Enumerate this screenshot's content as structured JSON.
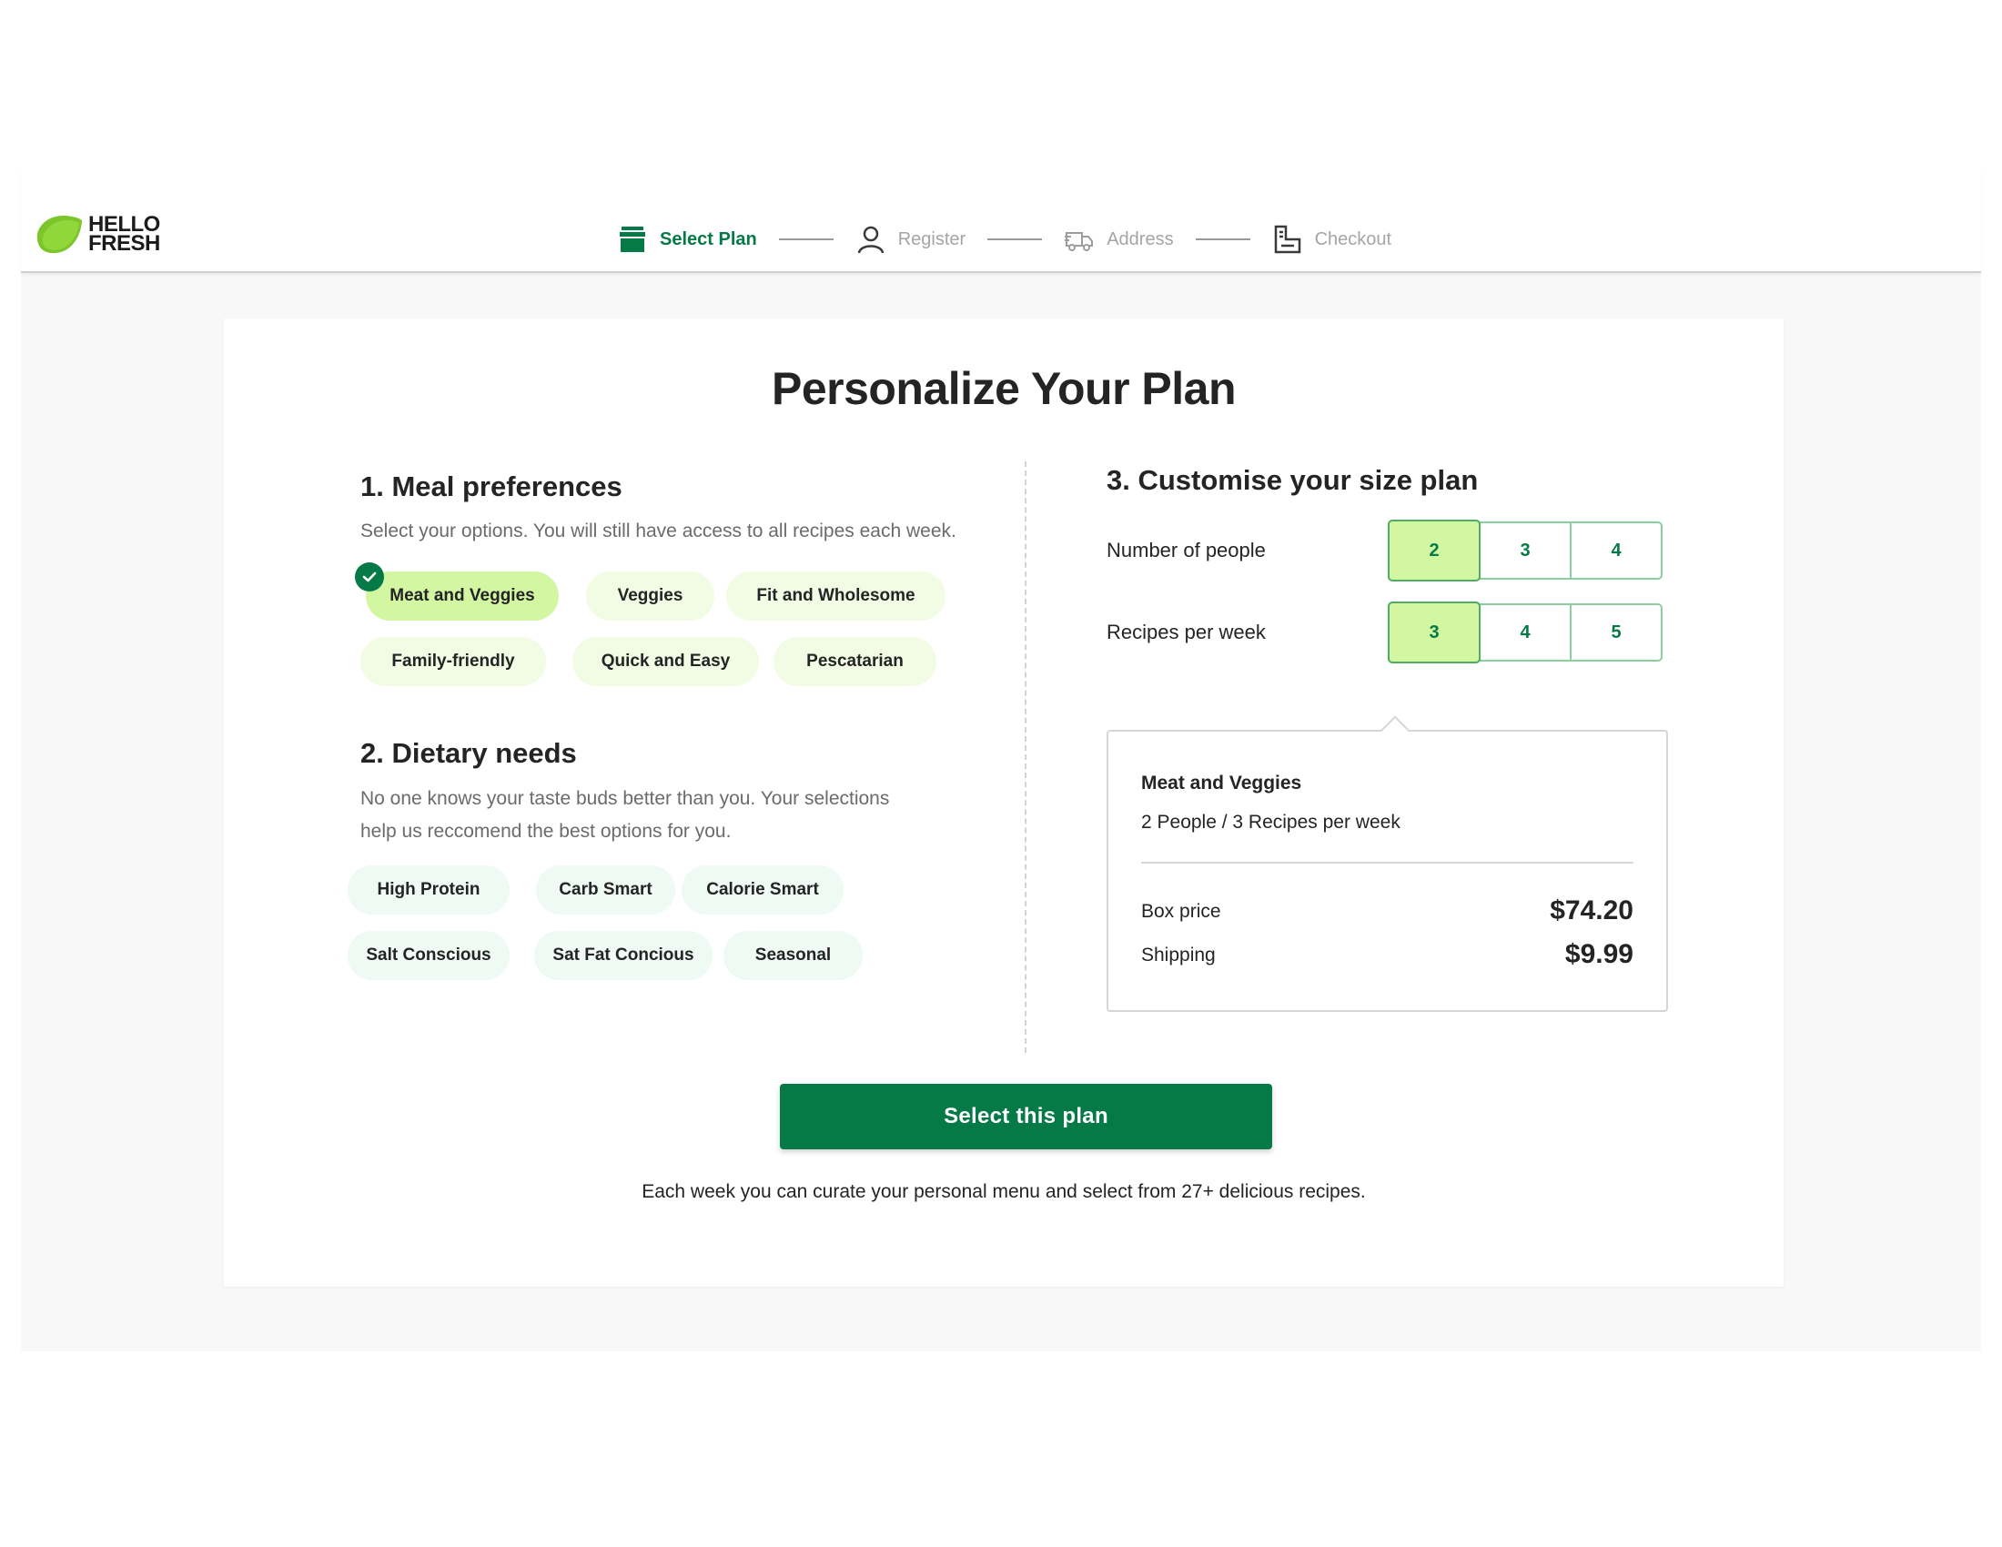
{
  "brand": {
    "logo_line1": "HELLO",
    "logo_line2": "FRESH",
    "accent": "#067a46",
    "lime": "#d3f6a2"
  },
  "steps": [
    {
      "label": "Select Plan",
      "icon": "box-icon",
      "active": true
    },
    {
      "label": "Register",
      "icon": "user-icon",
      "active": false
    },
    {
      "label": "Address",
      "icon": "truck-icon",
      "active": false
    },
    {
      "label": "Checkout",
      "icon": "checkout-icon",
      "active": false
    }
  ],
  "title": "Personalize Your Plan",
  "meal": {
    "heading": "1. Meal preferences",
    "subtitle": "Select your options. You will still have access to all recipes each week.",
    "options": [
      "Meat and Veggies",
      "Veggies",
      "Fit and Wholesome",
      "Family-friendly",
      "Quick and Easy",
      "Pescatarian"
    ],
    "selected": "Meat and Veggies"
  },
  "diet": {
    "heading": "2. Dietary needs",
    "subtitle_line1": "No one knows your taste buds better than you. Your selections",
    "subtitle_line2": "help us reccomend the best options for you.",
    "options": [
      "High Protein",
      "Carb Smart",
      "Calorie Smart",
      "Salt Conscious",
      "Sat Fat Concious",
      "Seasonal"
    ]
  },
  "size": {
    "heading": "3. Customise your size plan",
    "people_label": "Number of people",
    "people_options": [
      "2",
      "3",
      "4"
    ],
    "people_selected": "2",
    "recipes_label": "Recipes per week",
    "recipes_options": [
      "3",
      "4",
      "5"
    ],
    "recipes_selected": "3"
  },
  "summary": {
    "plan": "Meat and Veggies",
    "detail": "2 People / 3 Recipes per week",
    "box_label": "Box price",
    "box_value": "$74.20",
    "shipping_label": "Shipping",
    "shipping_value": "$9.99"
  },
  "cta": "Select this plan",
  "footnote": "Each week you can curate your personal menu and select from 27+ delicious recipes."
}
